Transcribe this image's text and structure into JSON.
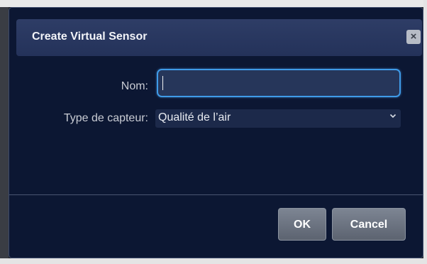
{
  "dialog": {
    "title": "Create Virtual Sensor",
    "close_label": "×"
  },
  "form": {
    "name_label": "Nom:",
    "name_value": "",
    "name_placeholder": "",
    "type_label": "Type de capteur:",
    "type_value": "Qualité de l’air"
  },
  "buttons": {
    "ok_label": "OK",
    "cancel_label": "Cancel"
  },
  "icons": {
    "close": "close-icon",
    "dropdown": "chevron-down-icon"
  },
  "colors": {
    "dialog_background": "#0c1733",
    "titlebar": "#2e3d66",
    "input_focus_border": "#3f9be8",
    "button": "#6b7280"
  }
}
